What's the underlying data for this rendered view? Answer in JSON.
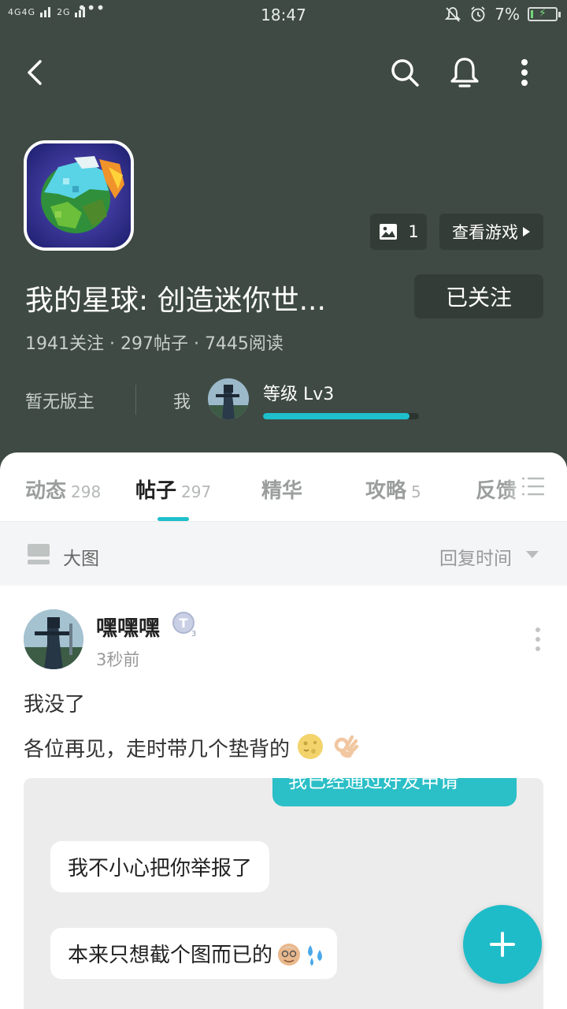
{
  "status_bar": {
    "network_left": "4G",
    "network_mid": "4G",
    "network_right": "2G",
    "more": "•••",
    "time": "18:47",
    "battery_percent": "7%",
    "battery_level": 0.07
  },
  "game": {
    "title": "我的星球: 创造迷你世...",
    "image_count": "1",
    "view_game_label": "查看游戏",
    "follow_label": "已关注",
    "stats": "1941关注 · 297帖子 · 7445阅读",
    "moderator_text": "暂无版主",
    "me_label": "我",
    "level_label": "等级 Lv3",
    "level_progress": 0.94
  },
  "tabs": [
    {
      "label": "动态",
      "count": "298"
    },
    {
      "label": "帖子",
      "count": "297"
    },
    {
      "label": "精华",
      "count": ""
    },
    {
      "label": "攻略",
      "count": "5"
    },
    {
      "label": "反馈",
      "count": ""
    }
  ],
  "filter": {
    "view_label": "大图",
    "sort_label": "回复时间"
  },
  "post": {
    "username": "嘿嘿嘿",
    "badge_letter": "T",
    "badge_level": "3",
    "time": "3秒前",
    "line1": "我没了",
    "line2": "各位再见，走时带几个垫背的",
    "image": {
      "bubble_top": "我已经通过好友申请",
      "bubble_1": "我不小心把你举报了",
      "bubble_2": "本来只想截个图而已的"
    }
  },
  "colors": {
    "header_bg": "#3f4a44",
    "accent": "#1ec0cc"
  },
  "icons": [
    "back-icon",
    "search-icon",
    "bell-icon",
    "more-vertical-icon",
    "image-icon",
    "play-arrow-icon",
    "menu-list-icon",
    "large-view-icon",
    "sort-caret-icon",
    "plus-icon"
  ]
}
